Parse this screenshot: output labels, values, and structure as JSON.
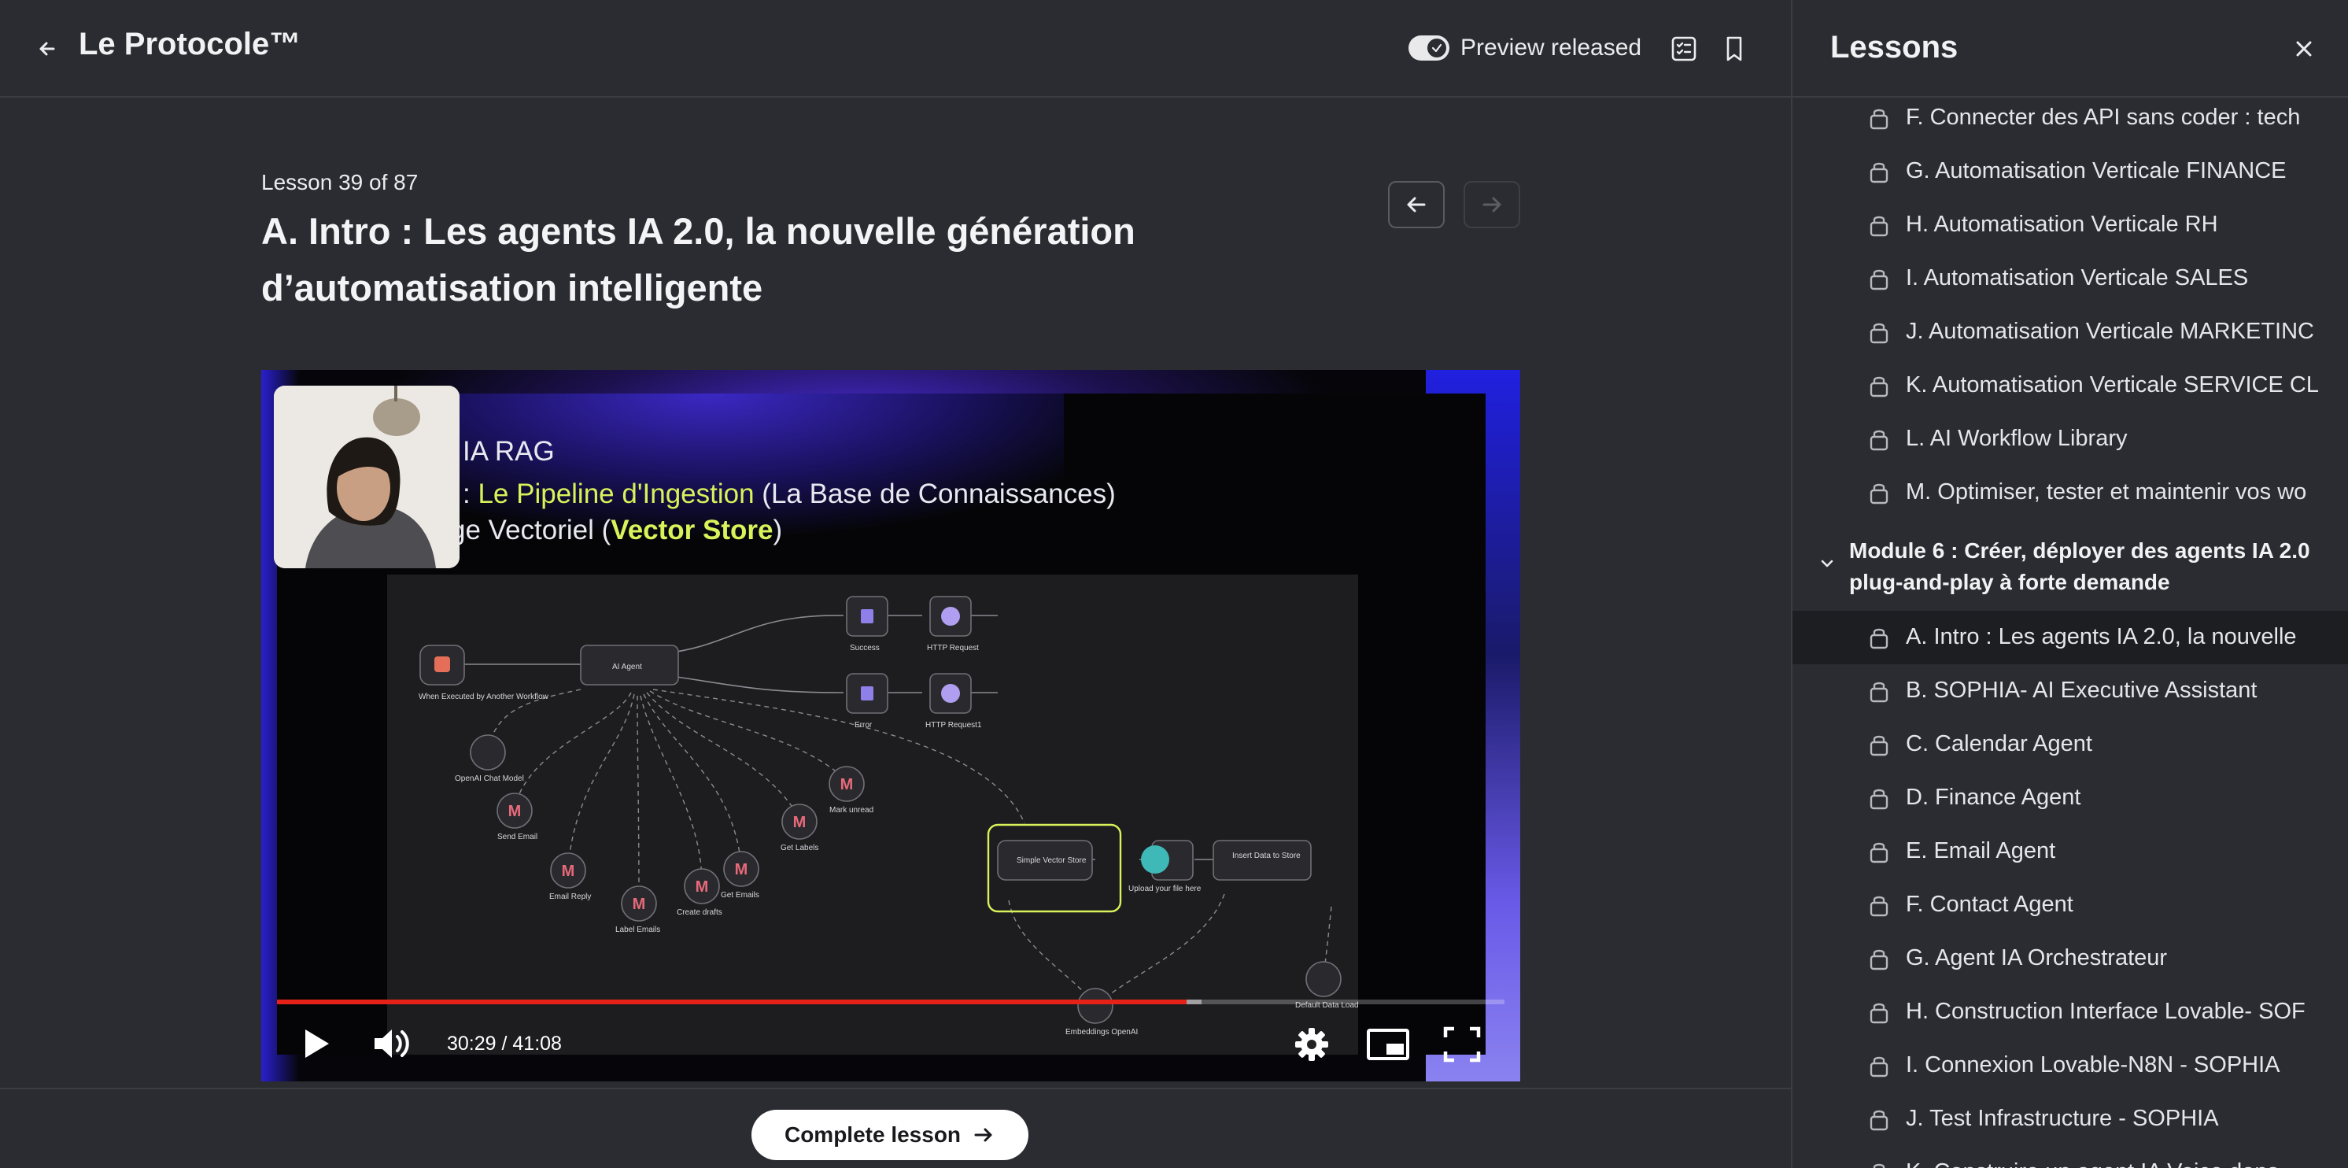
{
  "header": {
    "app_title": "Le Protocole™",
    "preview_label": "Preview released",
    "back_icon": "arrow-left-icon",
    "toggle_state": "on"
  },
  "lesson": {
    "count_label": "Lesson 39 of 87",
    "title": "A. Intro : Les agents IA 2.0, la nouvelle génération d’automatisation intelligente"
  },
  "video": {
    "slide_line1": "IA RAG",
    "slide_line2_prefix": ": ",
    "slide_line2_highlight": "Le Pipeline d'Ingestion",
    "slide_line2_suffix": " (La Base de Connaissances)",
    "slide_line3_prefix": "ge Vectoriel (",
    "slide_line3_highlight": "Vector Store",
    "slide_line3_suffix": ")",
    "time": "30:29 / 41:08",
    "progress": 0.741,
    "buffered": 0.753,
    "workflow": {
      "trigger": "When Executed by Another Workflow",
      "agent": "AI Agent",
      "success": "Success",
      "http1": "HTTP Request",
      "error": "Error",
      "http2": "HTTP Request1",
      "chat_model": "OpenAI Chat Model",
      "send_email": "Send Email",
      "email_reply": "Email Reply",
      "label_emails": "Label Emails",
      "create_drafts": "Create drafts",
      "get_emails": "Get Emails",
      "get_labels": "Get Labels",
      "mark_unread": "Mark unread",
      "vector_store": "Simple Vector Store",
      "upload": "Upload your file here",
      "insert": "Insert Data to Store",
      "embeddings": "Embeddings OpenAI",
      "loader": "Default Data Loader"
    }
  },
  "footer": {
    "complete_label": "Complete lesson"
  },
  "sidebar": {
    "title": "Lessons",
    "items_before": [
      "F. Connecter des API sans coder : tech",
      "G. Automatisation Verticale FINANCE",
      "H. Automatisation Verticale RH",
      "I. Automatisation Verticale SALES",
      "J. Automatisation Verticale MARKETINC",
      "K. Automatisation Verticale SERVICE CL",
      "L. AI Workflow Library",
      "M. Optimiser, tester et maintenir vos wo"
    ],
    "module_title": "Module 6 : Créer, déployer des agents IA 2.0 plug-and-play à forte demande",
    "items_after": [
      "A. Intro : Les agents IA 2.0, la nouvelle",
      "B. SOPHIA- AI Executive Assistant",
      "C. Calendar Agent",
      "D. Finance Agent",
      "E. Email Agent",
      "F. Contact Agent",
      "G. Agent IA Orchestrateur",
      "H. Construction Interface Lovable- SOF",
      "I. Connexion Lovable-N8N - SOPHIA",
      "J. Test Infrastructure - SOPHIA",
      "K. Construire un agent IA Voice dans"
    ],
    "active_index_after": 0
  }
}
